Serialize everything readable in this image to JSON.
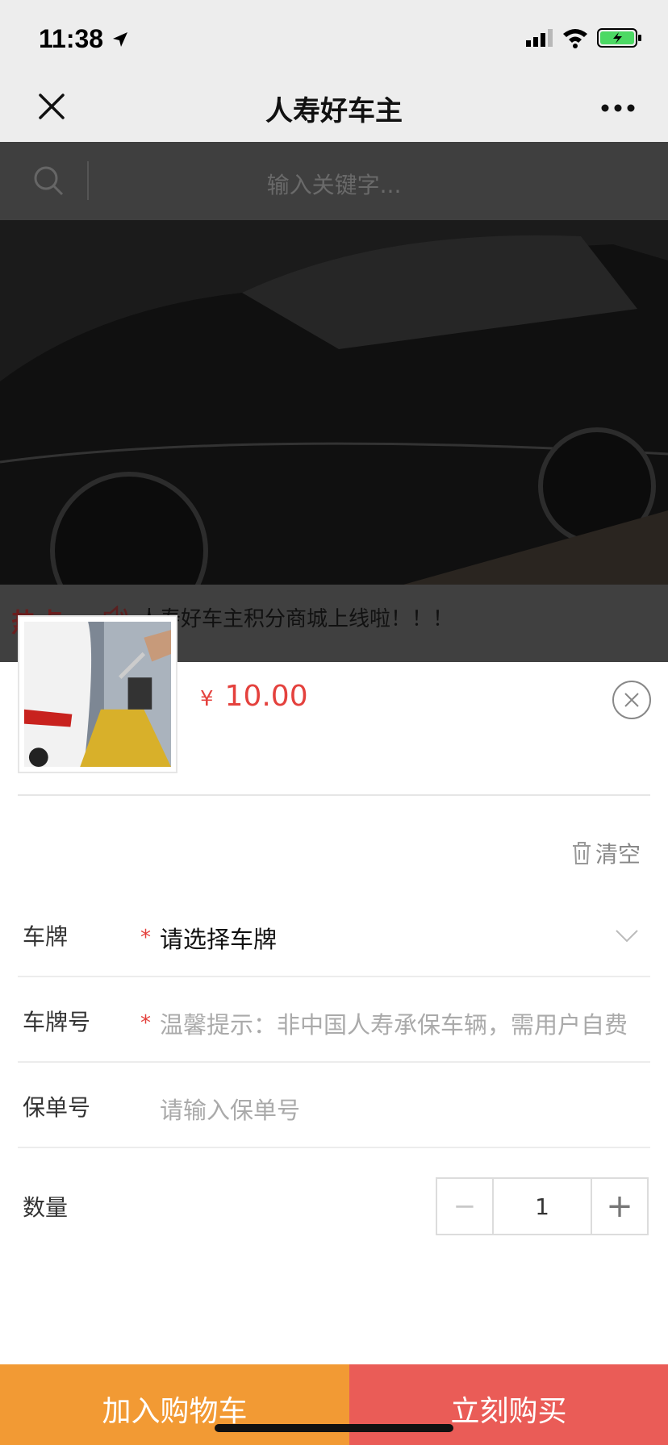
{
  "status_bar": {
    "time": "11:38"
  },
  "nav": {
    "title": "人寿好车主"
  },
  "background_page": {
    "search_placeholder": "输入关键字...",
    "hot_label": "热点",
    "hot_text": "人寿好车主积分商城上线啦！！！"
  },
  "product": {
    "price_symbol": "¥",
    "price": "10.00"
  },
  "form": {
    "clear_label": "清空",
    "plate_label": "车牌",
    "plate_value": "请选择车牌",
    "plate_number_label": "车牌号",
    "plate_number_placeholder": "温馨提示：非中国人寿承保车辆，需用户自费",
    "policy_label": "保单号",
    "policy_placeholder": "请输入保单号",
    "quantity_label": "数量",
    "quantity_value": "1",
    "minus_label": "−",
    "plus_label": "+"
  },
  "actions": {
    "add_to_cart": "加入购物车",
    "buy_now": "立刻购买"
  },
  "colors": {
    "price": "#e4413d",
    "cart_button": "#f29a34",
    "buy_button": "#ea5c57"
  }
}
